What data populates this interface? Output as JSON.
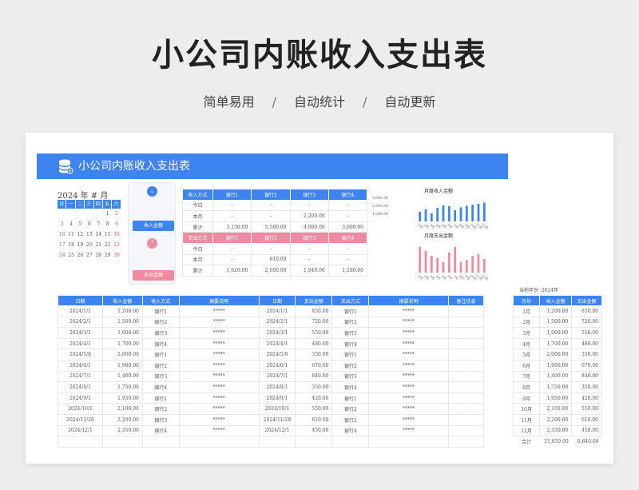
{
  "hero": {
    "title": "小公司内账收入支出表",
    "features": [
      "简单易用",
      "自动统计",
      "自动更新"
    ],
    "separator": "/"
  },
  "banner": {
    "title": "小公司内账收入支出表",
    "icon": "database-icon"
  },
  "calendar": {
    "header": "2024 年 # 月",
    "weekdays": [
      "日",
      "一",
      "二",
      "三",
      "四",
      "五",
      "六"
    ],
    "weeks": [
      [
        "",
        "",
        "",
        "",
        "",
        "1",
        "2"
      ],
      [
        "3",
        "4",
        "5",
        "6",
        "7",
        "8",
        "9"
      ],
      [
        "10",
        "11",
        "12",
        "13",
        "14",
        "15",
        "16"
      ],
      [
        "17",
        "18",
        "19",
        "20",
        "21",
        "22",
        "23"
      ],
      [
        "24",
        "25",
        "26",
        "27",
        "28",
        "29",
        "30"
      ]
    ]
  },
  "side": {
    "income_button": "收入金额",
    "expense_button": "支出金额",
    "income_icon": "chevron-down-icon",
    "expense_icon": "chevron-up-icon"
  },
  "summary": {
    "income_header": [
      "收入方式",
      "银行1",
      "银行2",
      "银行3",
      "银行4"
    ],
    "income_rows": [
      [
        "今日",
        "-",
        "-",
        "-",
        "-"
      ],
      [
        "本月",
        "-",
        "-",
        "2,200.00",
        "-"
      ],
      [
        "累计",
        "3,150.00",
        "5,500.00",
        "4,600.00",
        "3,600.00"
      ]
    ],
    "expense_header": [
      "支出方式",
      "银行1",
      "银行2",
      "银行3",
      "银行4"
    ],
    "expense_rows": [
      [
        "今日",
        "-",
        "-",
        "-",
        "-"
      ],
      [
        "本月",
        "-",
        "610.00",
        "-",
        "-"
      ],
      [
        "累计",
        "1,620.00",
        "2,000.00",
        "1,940.00",
        "1,280.00"
      ]
    ]
  },
  "charts": {
    "income": {
      "title": "月度收入金额",
      "color": "#3d84f0",
      "y_ticks": [
        "3,000.00",
        "2,000.00",
        "1,000.00",
        "-"
      ],
      "ylim": [
        0,
        3000
      ],
      "categories": [
        "1月",
        "2月",
        "3月",
        "4月",
        "5月",
        "6月",
        "7月",
        "8月",
        "9月",
        "10月",
        "11月",
        "12月"
      ],
      "values": [
        1200,
        1500,
        1000,
        1700,
        2000,
        1900,
        1400,
        1750,
        1950,
        2100,
        2200,
        2350
      ]
    },
    "expense": {
      "title": "月度支出金额",
      "color": "#f08aa0",
      "categories": [
        "1月",
        "2月",
        "3月",
        "4月",
        "5月",
        "6月",
        "7月",
        "8月",
        "9月",
        "10月",
        "11月",
        "12月"
      ],
      "values": [
        850,
        720,
        550,
        480,
        350,
        670,
        840,
        350,
        420,
        550,
        610,
        450
      ]
    }
  },
  "main_table": {
    "headers": [
      "日期",
      "收入金额",
      "收入方式",
      "摘要说明",
      "日期",
      "支出金额",
      "支出方式",
      "摘要说明",
      "备注信息"
    ],
    "rows": [
      [
        "2024/1/1",
        "1,200.00",
        "银行1",
        "*****",
        "2024/1/1",
        "850.00",
        "银行1",
        "*****",
        ""
      ],
      [
        "2024/2/1",
        "1,500.00",
        "银行2",
        "*****",
        "2024/2/1",
        "720.00",
        "银行2",
        "*****",
        ""
      ],
      [
        "2024/3/1",
        "1,000.00",
        "银行3",
        "*****",
        "2024/3/1",
        "550.00",
        "银行3",
        "*****",
        ""
      ],
      [
        "2024/4/1",
        "1,700.00",
        "银行4",
        "*****",
        "2024/4/1",
        "480.00",
        "银行4",
        "*****",
        ""
      ],
      [
        "2024/5/8",
        "2,000.00",
        "银行1",
        "*****",
        "2024/5/8",
        "350.00",
        "银行1",
        "*****",
        ""
      ],
      [
        "2024/6/1",
        "1,900.00",
        "银行2",
        "*****",
        "2024/6/1",
        "670.00",
        "银行2",
        "*****",
        ""
      ],
      [
        "2024/7/1",
        "1,400.00",
        "银行3",
        "*****",
        "2024/7/1",
        "840.00",
        "银行3",
        "*****",
        ""
      ],
      [
        "2024/8/1",
        "1,750.00",
        "银行4",
        "*****",
        "2024/8/1",
        "350.00",
        "银行4",
        "*****",
        ""
      ],
      [
        "2024/9/1",
        "1,950.00",
        "银行1",
        "*****",
        "2024/9/1",
        "420.00",
        "银行1",
        "*****",
        ""
      ],
      [
        "2024/10/1",
        "2,100.00",
        "银行2",
        "*****",
        "2024/10/1",
        "550.00",
        "银行2",
        "*****",
        ""
      ],
      [
        "2024/11/28",
        "2,200.00",
        "银行3",
        "*****",
        "2024/11/28",
        "610.00",
        "银行2",
        "*****",
        ""
      ],
      [
        "2024/12/1",
        "2,350.00",
        "银行4",
        "*****",
        "2024/12/1",
        "450.00",
        "银行4",
        "*****",
        ""
      ],
      [
        "",
        "",
        "",
        "",
        "",
        "",
        "",
        "",
        ""
      ]
    ]
  },
  "monthly": {
    "year_label": "当前年份",
    "year": "2024年",
    "headers": [
      "月份",
      "收入金额",
      "支出金额"
    ],
    "rows": [
      [
        "1月",
        "1,200.00",
        "850.00"
      ],
      [
        "2月",
        "1,500.00",
        "720.00"
      ],
      [
        "3月",
        "1,000.00",
        "550.00"
      ],
      [
        "4月",
        "1,700.00",
        "480.00"
      ],
      [
        "5月",
        "2,000.00",
        "350.00"
      ],
      [
        "6月",
        "1,900.00",
        "670.00"
      ],
      [
        "7月",
        "1,400.00",
        "840.00"
      ],
      [
        "8月",
        "1,750.00",
        "350.00"
      ],
      [
        "9月",
        "1,950.00",
        "420.00"
      ],
      [
        "10月",
        "2,100.00",
        "550.00"
      ],
      [
        "11月",
        "2,200.00",
        "610.00"
      ],
      [
        "12月",
        "2,350.00",
        "450.00"
      ]
    ],
    "total": [
      "合计",
      "21,050.00",
      "6,840.00"
    ]
  }
}
